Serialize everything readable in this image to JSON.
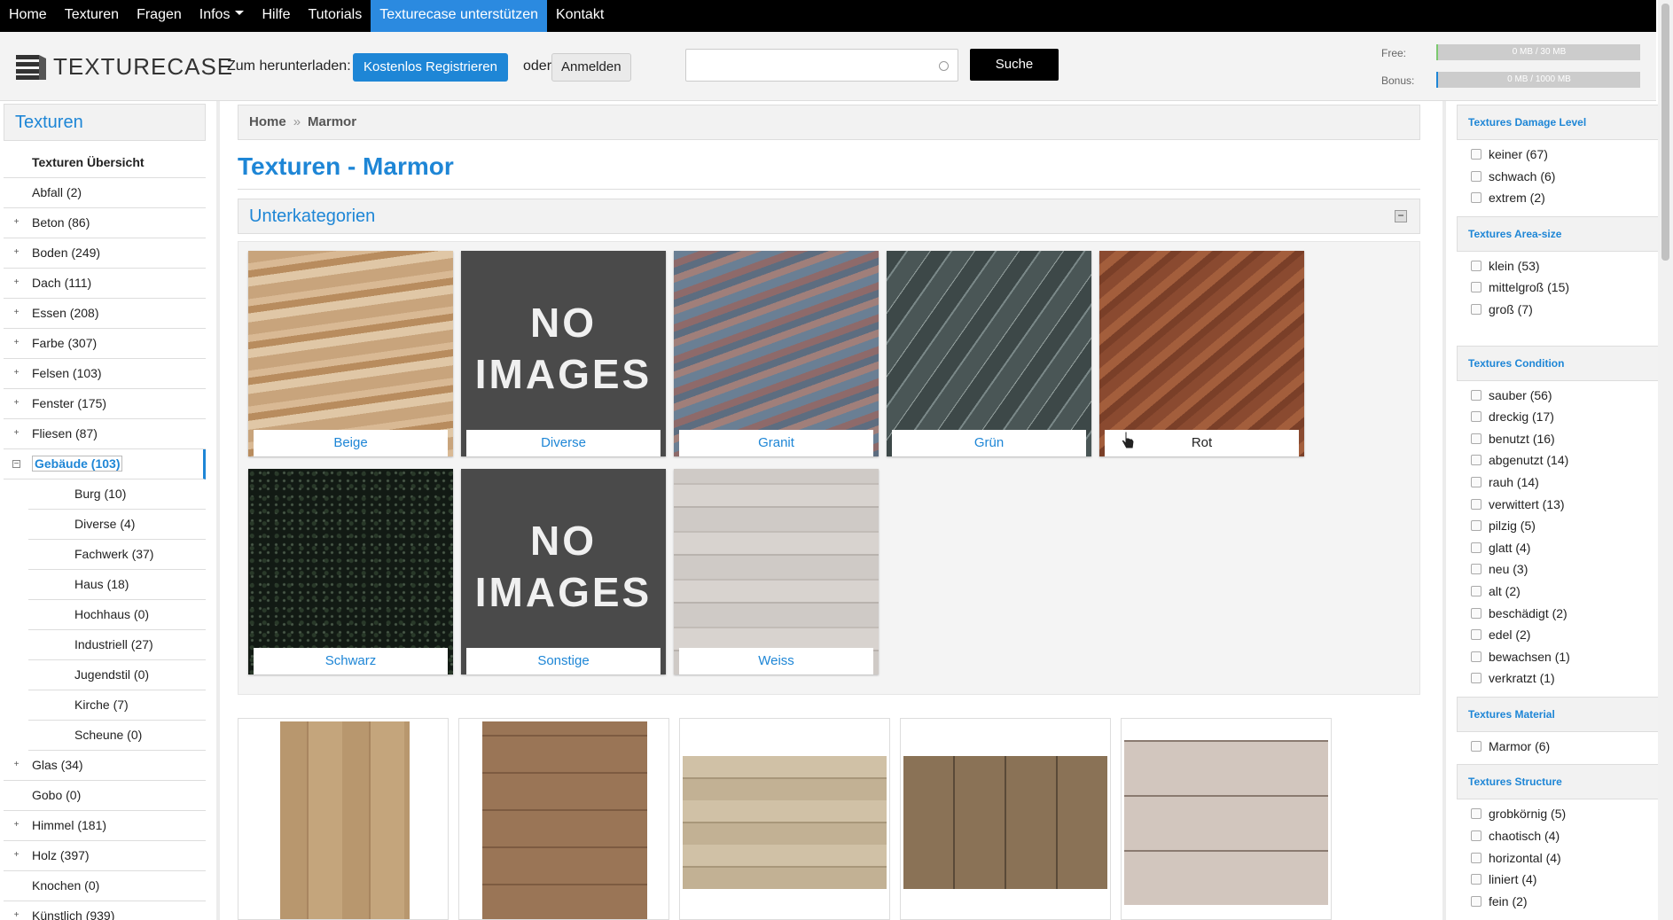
{
  "topnav": {
    "items": [
      "Home",
      "Texturen",
      "Fragen",
      "Infos",
      "Hilfe",
      "Tutorials",
      "Texturecase unterstützen",
      "Kontakt"
    ]
  },
  "header": {
    "logo": "TEXTURECASE",
    "download_label": "Zum herunterladen:",
    "register_button": "Kostenlos Registrieren",
    "or_label": "oder",
    "login_button": "Anmelden",
    "search_placeholder": "",
    "search_button": "Suche",
    "free_label": "Free:",
    "free_value": "0 MB / 30 MB",
    "bonus_label": "Bonus:",
    "bonus_value": "0 MB / 1000 MB"
  },
  "sidebar": {
    "title": "Texturen",
    "items": [
      {
        "label": "Texturen Übersicht",
        "type": "bold"
      },
      {
        "label": "Abfall (2)",
        "type": "leaf"
      },
      {
        "label": "Beton (86)",
        "type": "plus"
      },
      {
        "label": "Boden (249)",
        "type": "plus"
      },
      {
        "label": "Dach (111)",
        "type": "plus"
      },
      {
        "label": "Essen (208)",
        "type": "plus"
      },
      {
        "label": "Farbe (307)",
        "type": "plus"
      },
      {
        "label": "Felsen (103)",
        "type": "plus"
      },
      {
        "label": "Fenster (175)",
        "type": "plus"
      },
      {
        "label": "Fliesen (87)",
        "type": "plus"
      },
      {
        "label": "Gebäude (103)",
        "type": "active"
      },
      {
        "label": "Burg (10)",
        "type": "sub"
      },
      {
        "label": "Diverse (4)",
        "type": "sub"
      },
      {
        "label": "Fachwerk (37)",
        "type": "sub"
      },
      {
        "label": "Haus (18)",
        "type": "sub"
      },
      {
        "label": "Hochhaus (0)",
        "type": "sub"
      },
      {
        "label": "Industriell (27)",
        "type": "sub"
      },
      {
        "label": "Jugendstil (0)",
        "type": "sub"
      },
      {
        "label": "Kirche (7)",
        "type": "sub"
      },
      {
        "label": "Scheune (0)",
        "type": "sub"
      },
      {
        "label": "Glas (34)",
        "type": "plus"
      },
      {
        "label": "Gobo (0)",
        "type": "leaf"
      },
      {
        "label": "Himmel (181)",
        "type": "plus"
      },
      {
        "label": "Holz (397)",
        "type": "plus"
      },
      {
        "label": "Knochen (0)",
        "type": "leaf"
      },
      {
        "label": "Künstlich (939)",
        "type": "plus"
      }
    ]
  },
  "main": {
    "breadcrumb": [
      "Home",
      "Marmor"
    ],
    "title": "Texturen - Marmor",
    "sub_title": "Unterkategorien",
    "no_images_text": "NO IMAGES",
    "subcategories": [
      "Beige",
      "Diverse",
      "Granit",
      "Grün",
      "Rot",
      "Schwarz",
      "Sonstige",
      "Weiss"
    ]
  },
  "filters": [
    {
      "title": "Textures Damage Level",
      "options": [
        "keiner (67)",
        "schwach (6)",
        "extrem (2)"
      ]
    },
    {
      "title": "Textures Area-size",
      "options": [
        "klein (53)",
        "mittelgroß (15)",
        "groß (7)"
      ]
    },
    {
      "title": "Textures Condition",
      "options": [
        "sauber (56)",
        "dreckig (17)",
        "benutzt (16)",
        "abgenutzt (14)",
        "rauh (14)",
        "verwittert (13)",
        "pilzig (5)",
        "glatt (4)",
        "neu (3)",
        "alt (2)",
        "beschädigt (2)",
        "edel (2)",
        "bewachsen (1)",
        "verkratzt (1)"
      ]
    },
    {
      "title": "Textures Material",
      "options": [
        "Marmor (6)"
      ]
    },
    {
      "title": "Textures Structure",
      "options": [
        "grobkörnig (5)",
        "chaotisch (4)",
        "horizontal (4)",
        "liniert (4)",
        "fein (2)"
      ]
    }
  ],
  "colors": {
    "accent": "#1e86d6",
    "nav_bg": "#000000"
  }
}
